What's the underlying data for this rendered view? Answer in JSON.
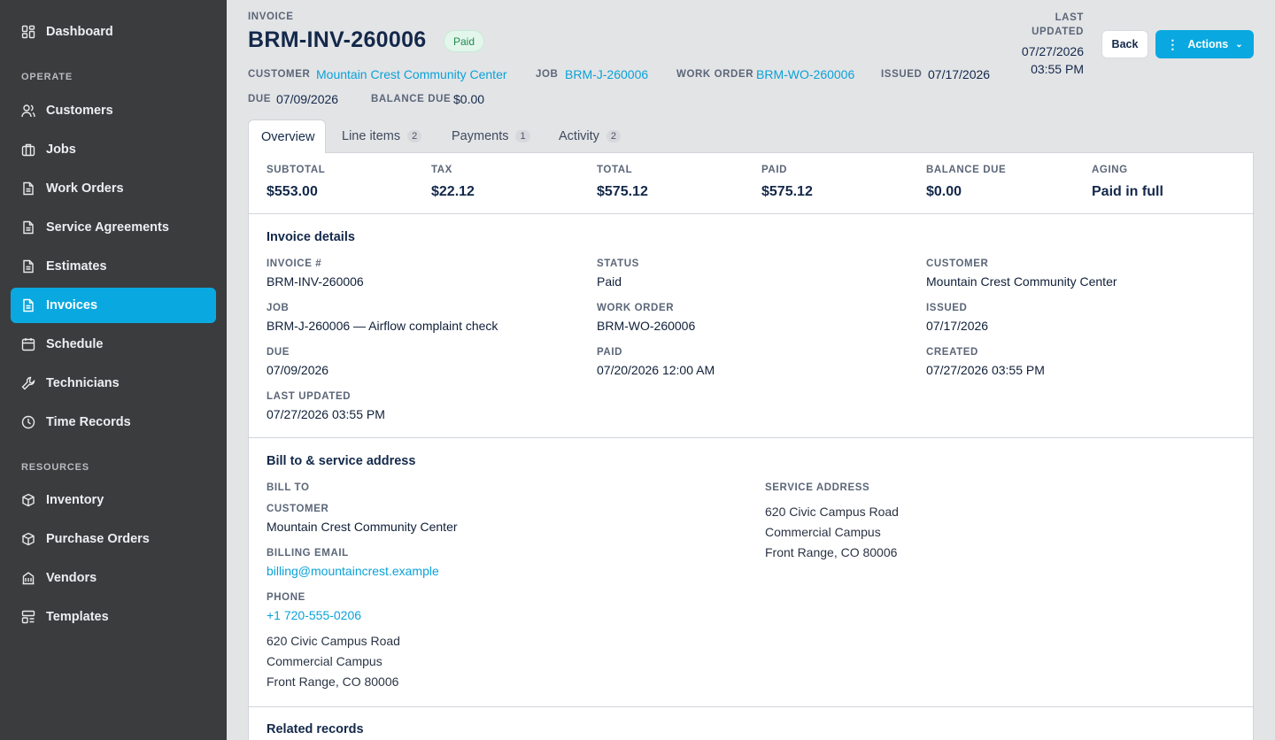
{
  "sidebar": {
    "items": [
      {
        "label": "Dashboard",
        "icon": "grid-icon"
      },
      {
        "label": "Customers",
        "icon": "users-icon"
      },
      {
        "label": "Jobs",
        "icon": "briefcase-icon"
      },
      {
        "label": "Work Orders",
        "icon": "document-icon"
      },
      {
        "label": "Service Agreements",
        "icon": "document-icon"
      },
      {
        "label": "Estimates",
        "icon": "document-icon"
      },
      {
        "label": "Invoices",
        "icon": "document-icon"
      },
      {
        "label": "Schedule",
        "icon": "calendar-icon"
      },
      {
        "label": "Technicians",
        "icon": "wrench-icon"
      },
      {
        "label": "Time Records",
        "icon": "clock-icon"
      },
      {
        "label": "Inventory",
        "icon": "box-icon"
      },
      {
        "label": "Purchase Orders",
        "icon": "box-icon"
      },
      {
        "label": "Vendors",
        "icon": "building-icon"
      },
      {
        "label": "Templates",
        "icon": "layout-icon"
      }
    ],
    "sections": {
      "operate": "OPERATE",
      "resources": "RESOURCES"
    },
    "active": "Invoices",
    "accent": "#0aa8e0"
  },
  "header": {
    "eyebrow": "INVOICE",
    "title": "BRM-INV-260006",
    "status_badge": "Paid",
    "customer_label": "CUSTOMER",
    "customer": "Mountain Crest Community Center",
    "job_label": "JOB",
    "job": "BRM-J-260006",
    "work_order_label": "WORK ORDER",
    "work_order": "BRM-WO-260006",
    "issued_label": "ISSUED",
    "issued": "07/17/2026",
    "due_label": "DUE",
    "due": "07/09/2026",
    "balance_label": "BALANCE DUE",
    "balance": "$0.00",
    "last_updated_label_1": "LAST",
    "last_updated_label_2": "UPDATED",
    "last_updated_date": "07/27/2026",
    "last_updated_time": "03:55 PM",
    "back_label": "Back",
    "actions_label": "Actions"
  },
  "tabs": [
    {
      "label": "Overview",
      "count": null
    },
    {
      "label": "Line items",
      "count": "2"
    },
    {
      "label": "Payments",
      "count": "1"
    },
    {
      "label": "Activity",
      "count": "2"
    }
  ],
  "summary": [
    {
      "label": "SUBTOTAL",
      "value": "$553.00"
    },
    {
      "label": "TAX",
      "value": "$22.12"
    },
    {
      "label": "TOTAL",
      "value": "$575.12"
    },
    {
      "label": "PAID",
      "value": "$575.12"
    },
    {
      "label": "BALANCE DUE",
      "value": "$0.00"
    },
    {
      "label": "AGING",
      "value": "Paid in full"
    }
  ],
  "details": {
    "title": "Invoice details",
    "fields": [
      {
        "label": "INVOICE #",
        "value": "BRM-INV-260006"
      },
      {
        "label": "STATUS",
        "value": "Paid"
      },
      {
        "label": "CUSTOMER",
        "value": "Mountain Crest Community Center"
      },
      {
        "label": "JOB",
        "value": "BRM-J-260006 — Airflow complaint check"
      },
      {
        "label": "WORK ORDER",
        "value": "BRM-WO-260006"
      },
      {
        "label": "ISSUED",
        "value": "07/17/2026"
      },
      {
        "label": "DUE",
        "value": "07/09/2026"
      },
      {
        "label": "PAID",
        "value": "07/20/2026 12:00 AM"
      },
      {
        "label": "CREATED",
        "value": "07/27/2026 03:55 PM"
      },
      {
        "label": "LAST UPDATED",
        "value": "07/27/2026 03:55 PM"
      }
    ]
  },
  "billing": {
    "title": "Bill to & service address",
    "bill_to_label": "BILL TO",
    "customer_label": "CUSTOMER",
    "customer": "Mountain Crest Community Center",
    "email_label": "BILLING EMAIL",
    "email": "billing@mountaincrest.example",
    "phone_label": "PHONE",
    "phone": "+1 720-555-0206",
    "bill_address": [
      "620 Civic Campus Road",
      "Commercial Campus",
      "Front Range, CO 80006"
    ],
    "service_label": "SERVICE ADDRESS",
    "service_address": [
      "620 Civic Campus Road",
      "Commercial Campus",
      "Front Range, CO 80006"
    ]
  },
  "related": {
    "title": "Related records"
  }
}
